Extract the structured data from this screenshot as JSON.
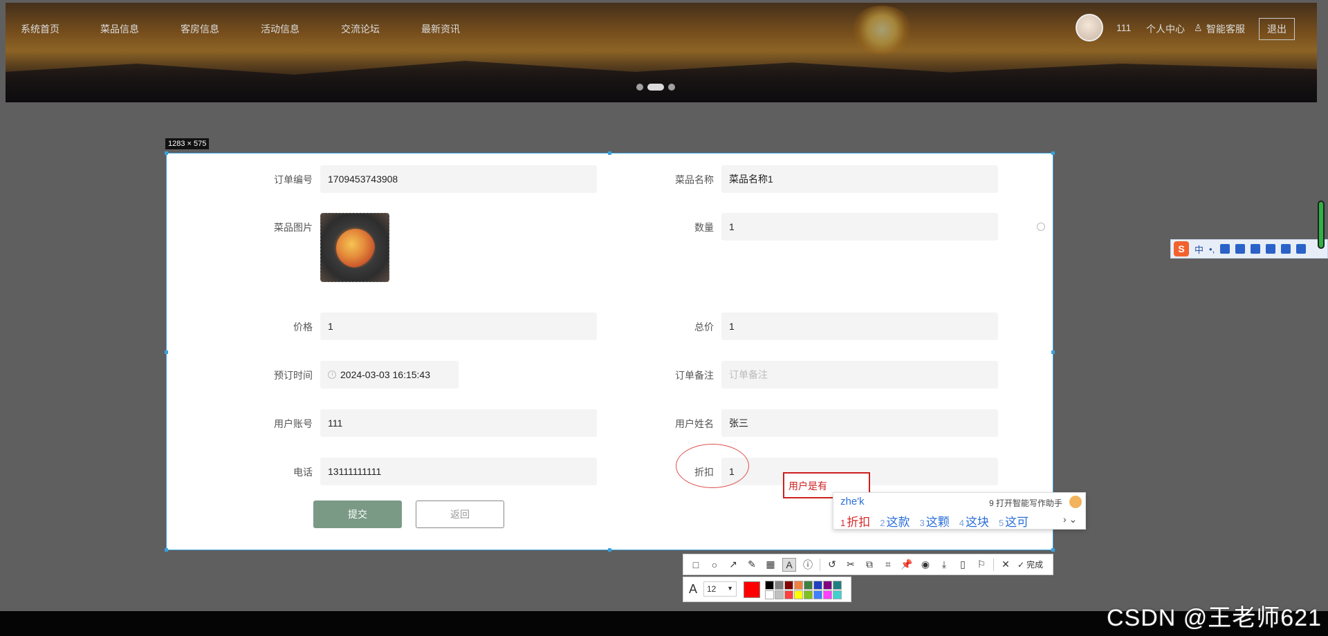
{
  "nav": {
    "items": [
      "系统首页",
      "菜品信息",
      "客房信息",
      "活动信息",
      "交流论坛",
      "最新资讯"
    ],
    "username": "111",
    "personal_center": "个人中心",
    "smart_service": "智能客服",
    "logout": "退出"
  },
  "screenshot": {
    "size_label": "1283 × 575"
  },
  "form": {
    "order_no": {
      "label": "订单编号",
      "value": "1709453743908"
    },
    "dish_name": {
      "label": "菜品名称",
      "value": "菜品名称1"
    },
    "dish_image": {
      "label": "菜品图片"
    },
    "quantity": {
      "label": "数量",
      "value": "1"
    },
    "price": {
      "label": "价格",
      "value": "1"
    },
    "total": {
      "label": "总价",
      "value": "1"
    },
    "booking_time": {
      "label": "预订时间",
      "value": "2024-03-03 16:15:43"
    },
    "remark": {
      "label": "订单备注",
      "placeholder": "订单备注"
    },
    "account": {
      "label": "用户账号",
      "value": "111"
    },
    "name": {
      "label": "用户姓名",
      "value": "张三"
    },
    "phone": {
      "label": "电话",
      "value": "13111111111"
    },
    "discount": {
      "label": "折扣",
      "value": "1"
    },
    "submit": "提交",
    "back": "返回"
  },
  "annotation": {
    "text": "用户是有"
  },
  "ime": {
    "pinyin": "zhe'k",
    "assistant": "9 打开智能写作助手",
    "candidates": [
      {
        "n": "1",
        "text": "折扣"
      },
      {
        "n": "2",
        "text": "这款"
      },
      {
        "n": "3",
        "text": "这颗"
      },
      {
        "n": "4",
        "text": "这块"
      },
      {
        "n": "5",
        "text": "这可"
      }
    ],
    "more": "› ⌄"
  },
  "sogou": {
    "logo": "S",
    "mode": "中",
    "punct": "•,"
  },
  "toolbar": {
    "done": "完成",
    "font_size": "12",
    "current_color": "#ff0000",
    "swatches": [
      "#000000",
      "#808080",
      "#800000",
      "#f08040",
      "#408040",
      "#2040c0",
      "#800080",
      "#208080",
      "#ffffff",
      "#c0c0c0",
      "#ff4040",
      "#ffff00",
      "#80c020",
      "#4080ff",
      "#ff40ff",
      "#40d0d0"
    ]
  },
  "watermark": "CSDN @王老师621"
}
